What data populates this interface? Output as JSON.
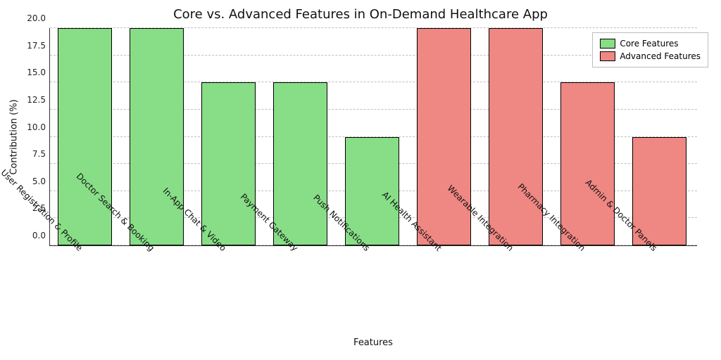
{
  "chart_data": {
    "type": "bar",
    "title": "Core vs. Advanced Features in On-Demand Healthcare App",
    "xlabel": "Features",
    "ylabel": "Contribution (%)",
    "ylim": [
      0,
      20
    ],
    "y_ticks": [
      "0.0",
      "2.5",
      "5.0",
      "7.5",
      "10.0",
      "12.5",
      "15.0",
      "17.5",
      "20.0"
    ],
    "categories": [
      "User Registration & Profile",
      "Doctor Search & Booking",
      "In-App Chat & Video",
      "Payment Gateway",
      "Push Notifications",
      "AI Health Assistant",
      "Wearable Integration",
      "Pharmacy Integration",
      "Admin & Doctor Panels"
    ],
    "series": [
      {
        "name": "Core Features",
        "values": [
          20,
          20,
          15,
          15,
          10,
          null,
          null,
          null,
          null
        ]
      },
      {
        "name": "Advanced Features",
        "values": [
          null,
          null,
          null,
          null,
          null,
          20,
          20,
          15,
          10
        ]
      }
    ],
    "legend": {
      "core": "Core Features",
      "advanced": "Advanced Features"
    },
    "colors": {
      "core": "#87de87",
      "advanced": "#ef8783"
    }
  }
}
